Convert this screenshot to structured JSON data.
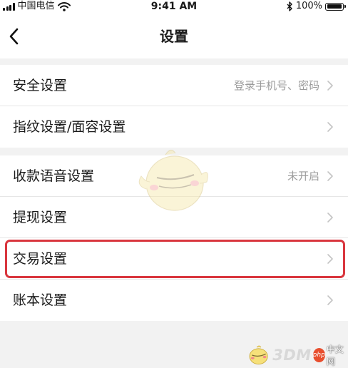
{
  "status_bar": {
    "carrier": "中国电信",
    "time": "9:41 AM",
    "battery_percent_label": "100%",
    "battery_level": 1.0,
    "icons": [
      "signal-bars-icon",
      "wifi-icon",
      "bluetooth-icon",
      "battery-icon"
    ]
  },
  "nav": {
    "title": "设置",
    "back_icon": "chevron-left-icon"
  },
  "groups": [
    {
      "items": [
        {
          "label": "安全设置",
          "value": "登录手机号、密码"
        },
        {
          "label": "指纹设置/面容设置",
          "value": ""
        }
      ]
    },
    {
      "items": [
        {
          "label": "收款语音设置",
          "value": "未开启"
        },
        {
          "label": "提现设置",
          "value": ""
        },
        {
          "label": "交易设置",
          "value": "",
          "highlighted": true
        },
        {
          "label": "账本设置",
          "value": ""
        }
      ]
    }
  ],
  "colors": {
    "background": "#f2f2f2",
    "card": "#ffffff",
    "highlight": "#d9363e",
    "secondary_text": "#9b9b9b"
  },
  "watermark": {
    "text": "3DM",
    "badge": "php",
    "site": "中文网"
  }
}
